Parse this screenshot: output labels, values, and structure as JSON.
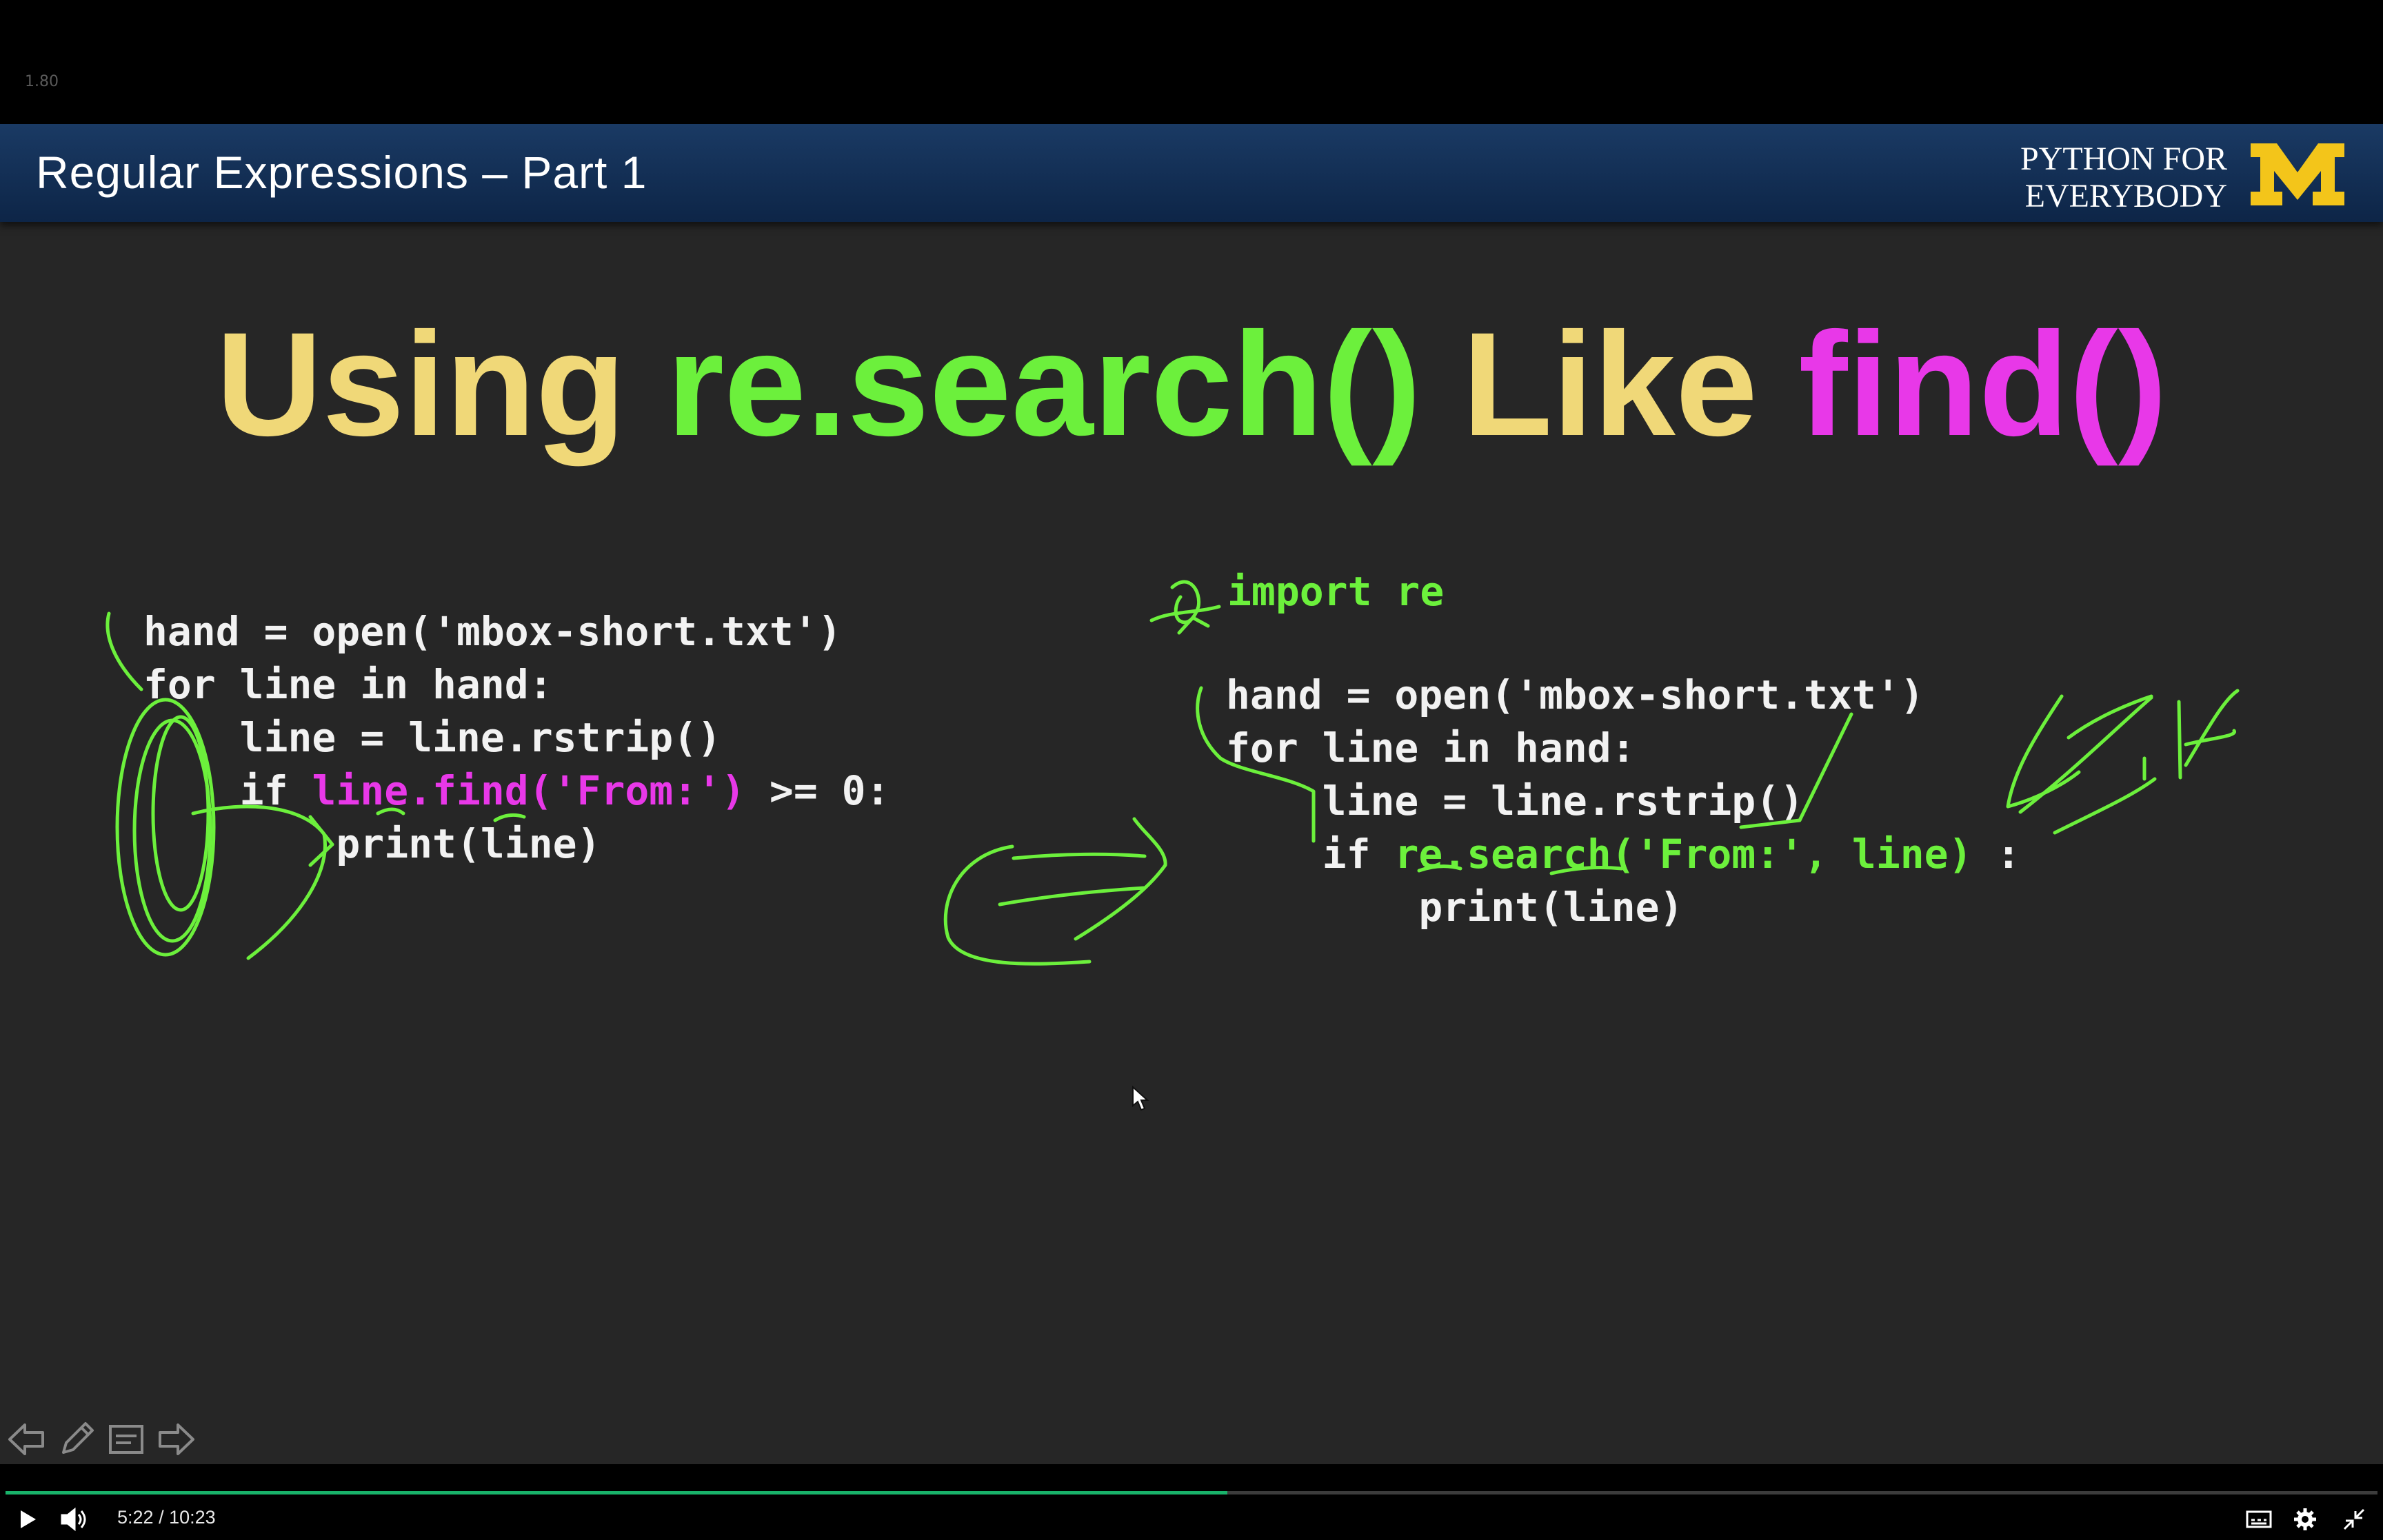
{
  "player": {
    "speed": "1.80",
    "current_time": "5:22",
    "separator": "/",
    "duration": "10:23",
    "progress": 0.515,
    "icons": [
      "play-icon",
      "volume-icon",
      "captions-icon",
      "settings-icon",
      "exit-fullscreen-icon"
    ]
  },
  "slide": {
    "banner_title": "Regular Expressions – Part 1",
    "brand_line1": "PYTHON FOR",
    "brand_line2": "EVERYBODY",
    "heading": {
      "part1": "Using ",
      "part2": "re.search()",
      "part3": " Like ",
      "part4": "find()"
    },
    "left_code": {
      "line1": "hand = open('mbox-short.txt')",
      "line2": "for line in hand:",
      "line3": "    line = line.rstrip()",
      "line4_pre": "    if ",
      "line4_hl": "line.find('From:')",
      "line4_post": " >= 0:",
      "line5": "        print(line)"
    },
    "right_code": {
      "import_line": "import re",
      "line1": "hand = open('mbox-short.txt')",
      "line2": "for line in hand:",
      "line3": "    line = line.rstrip()",
      "line4_pre": "    if ",
      "line4_hl": "re.search('From:', line)",
      "line4_post": " :",
      "line5": "        print(line)"
    },
    "annotation_color": "#6cf03c"
  },
  "slide_tools": {
    "icons": [
      "previous-slide-icon",
      "pen-icon",
      "notes-icon",
      "next-slide-icon"
    ]
  }
}
